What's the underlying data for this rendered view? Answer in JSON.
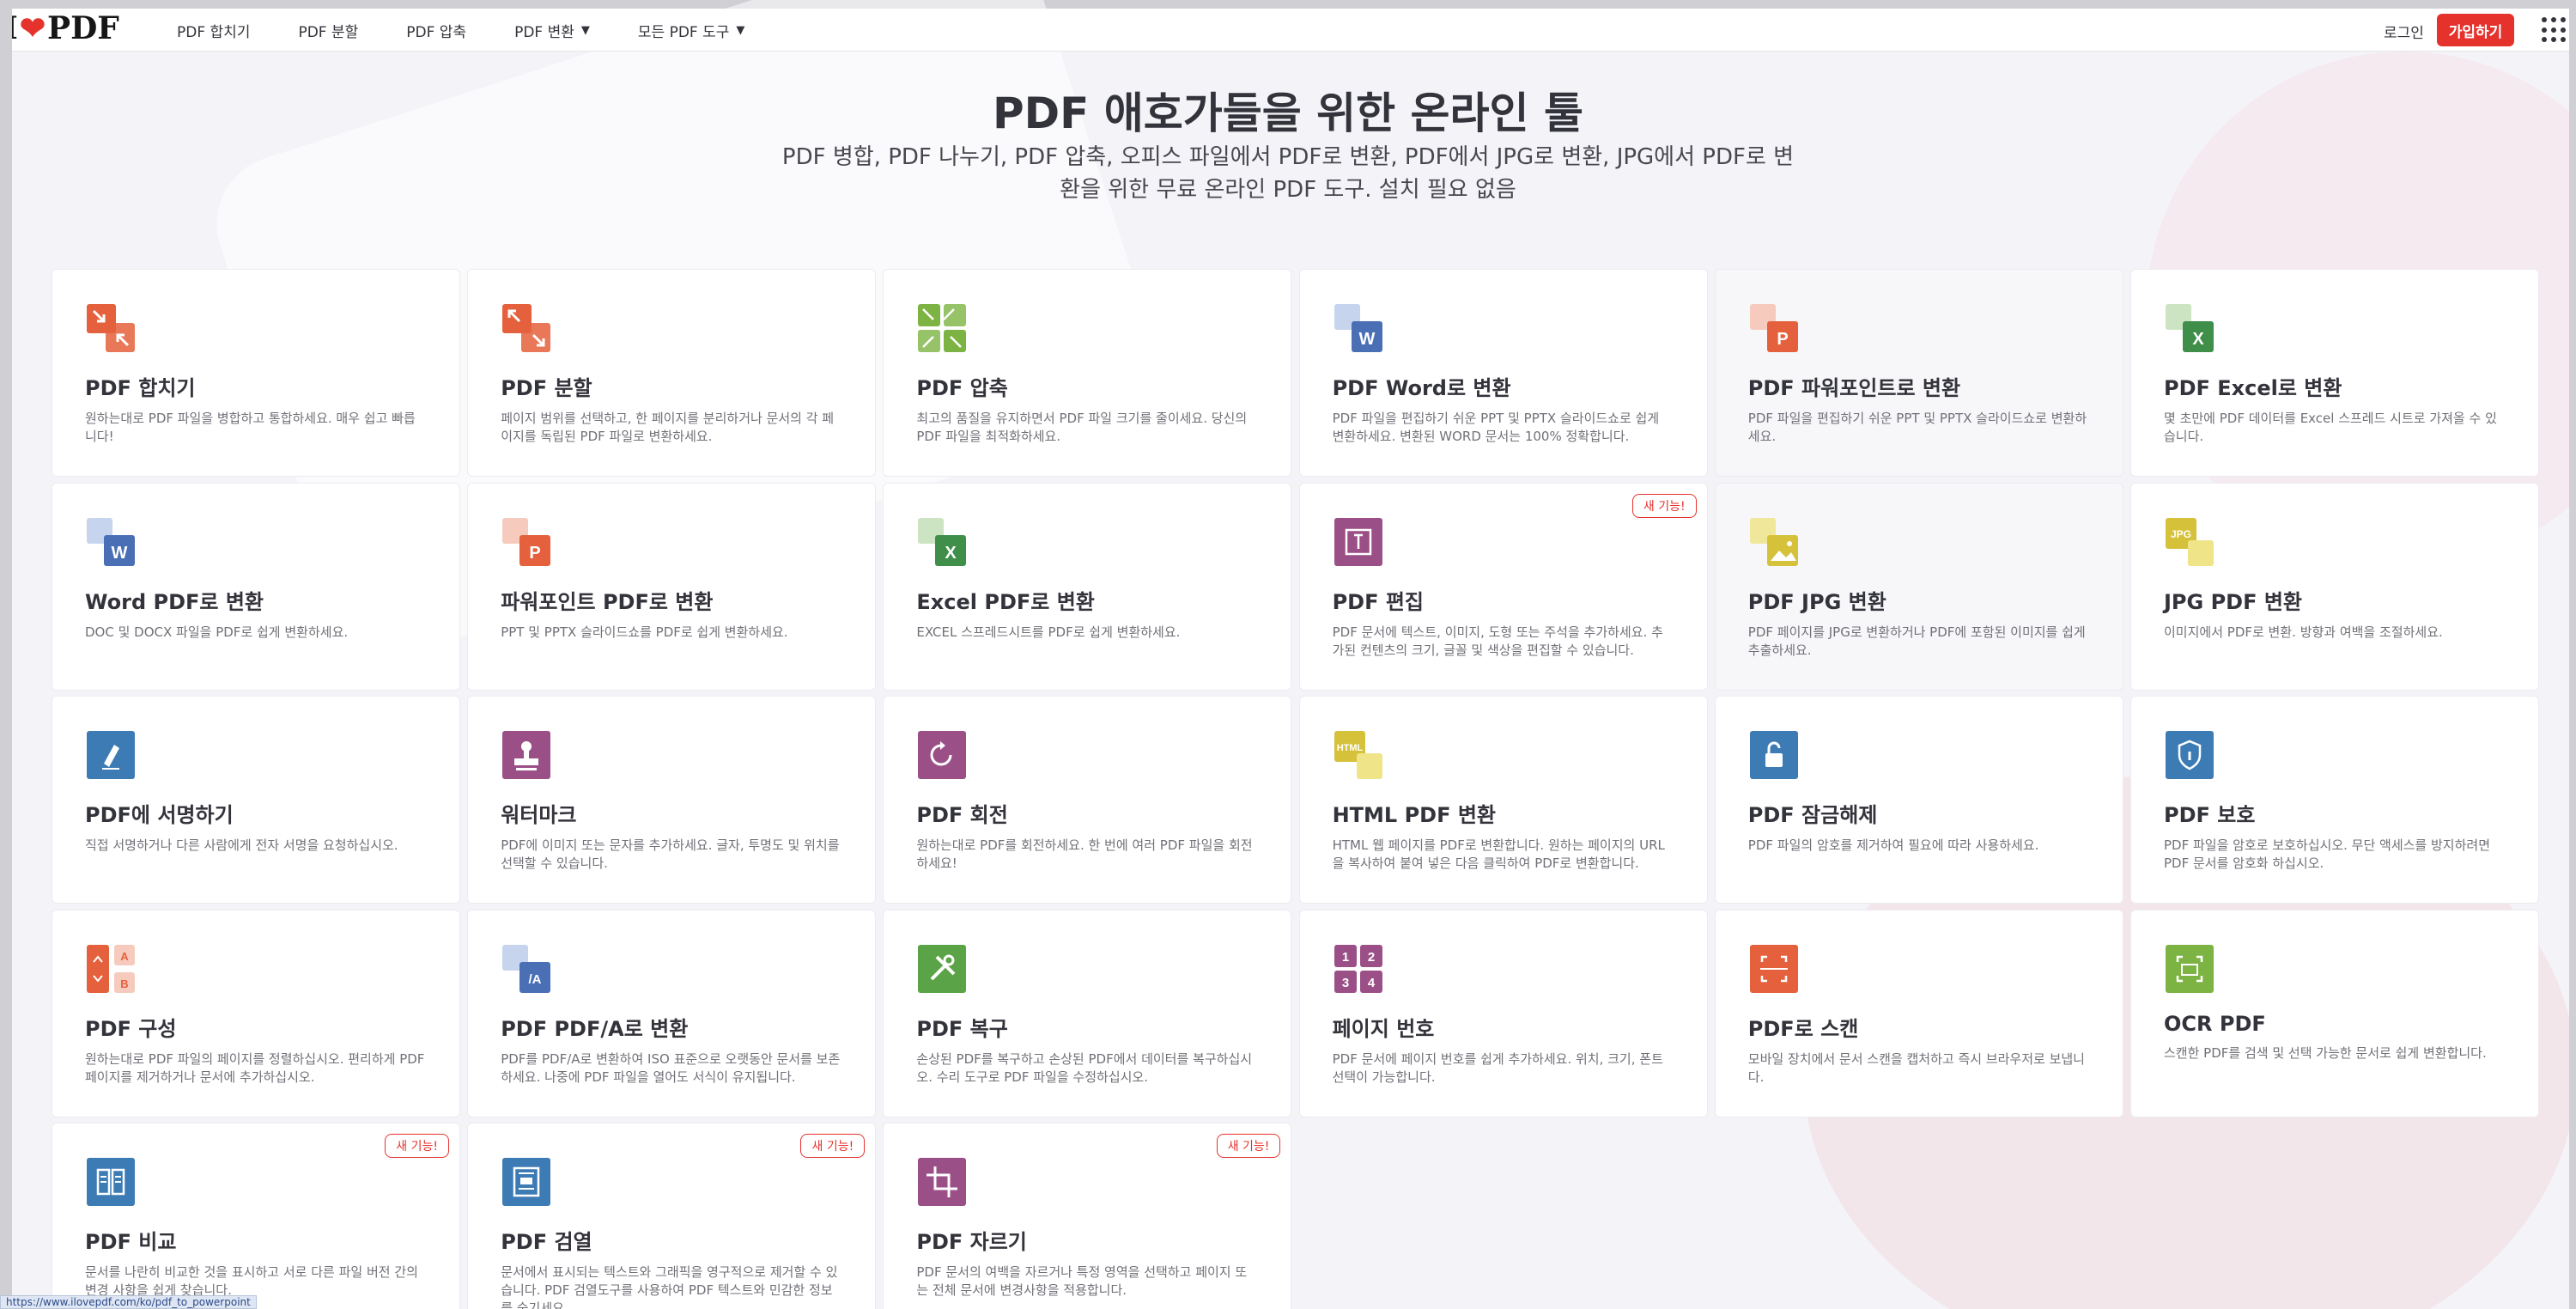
{
  "header": {
    "logo": {
      "prefix": "I",
      "suffix": "PDF"
    },
    "nav": [
      {
        "label": "PDF 합치기",
        "caret": false
      },
      {
        "label": "PDF 분할",
        "caret": false
      },
      {
        "label": "PDF 압축",
        "caret": false
      },
      {
        "label": "PDF 변환",
        "caret": true
      },
      {
        "label": "모든 PDF 도구",
        "caret": true
      }
    ],
    "login_label": "로그인",
    "signup_label": "가입하기"
  },
  "hero": {
    "title": "PDF 애호가들을 위한 온라인 툴",
    "subtitle": "PDF 병합, PDF 나누기, PDF 압축, 오피스 파일에서 PDF로 변환, PDF에서 JPG로 변환, JPG에서 PDF로 변환을 위한 무료 온라인 PDF 도구. 설치 필요 없음"
  },
  "new_badge_label": "새 기능!",
  "status_url": "https://www.ilovepdf.com/ko/pdf_to_powerpoint",
  "colors": {
    "brand": "#e5322d",
    "orange": "#e5603c",
    "green": "#7cb342",
    "blue": "#4a6fb5",
    "purple": "#9b4f87",
    "yellow": "#d6c13a",
    "teal": "#3d7bb5"
  },
  "tools": [
    {
      "name": "merge",
      "icon": "merge-icon",
      "title": "PDF 합치기",
      "desc": "원하는대로 PDF 파일을 병합하고 통합하세요. 매우 쉽고 빠릅니다!",
      "new": false
    },
    {
      "name": "split",
      "icon": "split-icon",
      "title": "PDF 분할",
      "desc": "페이지 범위를 선택하고, 한 페이지를 분리하거나 문서의 각 페이지를 독립된 PDF 파일로 변환하세요.",
      "new": false
    },
    {
      "name": "compress",
      "icon": "compress-icon",
      "title": "PDF 압축",
      "desc": "최고의 품질을 유지하면서 PDF 파일 크기를 줄이세요. 당신의 PDF 파일을 최적화하세요.",
      "new": false
    },
    {
      "name": "pdf-to-word",
      "icon": "word-icon",
      "title": "PDF Word로 변환",
      "desc": "PDF 파일을 편집하기 쉬운 PPT 및 PPTX 슬라이드쇼로 쉽게 변환하세요. 변환된 WORD 문서는 100% 정확합니다.",
      "new": false
    },
    {
      "name": "pdf-to-powerpoint",
      "icon": "powerpoint-icon",
      "title": "PDF 파워포인트로 변환",
      "desc": "PDF 파일을 편집하기 쉬운 PPT 및 PPTX 슬라이드쇼로 변환하세요.",
      "new": false
    },
    {
      "name": "pdf-to-excel",
      "icon": "excel-icon",
      "title": "PDF Excel로 변환",
      "desc": "몇 초만에 PDF 데이터를 Excel 스프레드 시트로 가져올 수 있습니다.",
      "new": false
    },
    {
      "name": "word-to-pdf",
      "icon": "word-icon",
      "title": "Word PDF로 변환",
      "desc": "DOC 및 DOCX 파일을 PDF로 쉽게 변환하세요.",
      "new": false
    },
    {
      "name": "powerpoint-to-pdf",
      "icon": "powerpoint-icon",
      "title": "파워포인트 PDF로 변환",
      "desc": "PPT 및 PPTX 슬라이드쇼를 PDF로 쉽게 변환하세요.",
      "new": false
    },
    {
      "name": "excel-to-pdf",
      "icon": "excel-icon",
      "title": "Excel PDF로 변환",
      "desc": "EXCEL 스프레드시트를 PDF로 쉽게 변환하세요.",
      "new": false
    },
    {
      "name": "edit",
      "icon": "edit-icon",
      "title": "PDF 편집",
      "desc": "PDF 문서에 텍스트, 이미지, 도형 또는 주석을 추가하세요. 추가된 컨텐츠의 크기, 글꼴 및 색상을 편집할 수 있습니다.",
      "new": true
    },
    {
      "name": "pdf-to-jpg",
      "icon": "image-icon",
      "title": "PDF JPG 변환",
      "desc": "PDF 페이지를 JPG로 변환하거나 PDF에 포함된 이미지를 쉽게 추출하세요.",
      "new": false
    },
    {
      "name": "jpg-to-pdf",
      "icon": "jpg-icon",
      "title": "JPG PDF 변환",
      "desc": "이미지에서 PDF로 변환. 방향과 여백을 조절하세요.",
      "new": false
    },
    {
      "name": "sign",
      "icon": "pen-icon",
      "title": "PDF에 서명하기",
      "desc": "직접 서명하거나 다른 사람에게 전자 서명을 요청하십시오.",
      "new": false
    },
    {
      "name": "watermark",
      "icon": "stamp-icon",
      "title": "워터마크",
      "desc": "PDF에 이미지 또는 문자를 추가하세요. 글자, 투명도 및 위치를 선택할 수 있습니다.",
      "new": false
    },
    {
      "name": "rotate",
      "icon": "rotate-icon",
      "title": "PDF 회전",
      "desc": "원하는대로 PDF를 회전하세요. 한 번에 여러 PDF 파일을 회전하세요!",
      "new": false
    },
    {
      "name": "html-to-pdf",
      "icon": "html-icon",
      "title": "HTML PDF 변환",
      "desc": "HTML 웹 페이지를 PDF로 변환합니다. 원하는 페이지의 URL을 복사하여 붙여 넣은 다음 클릭하여 PDF로 변환합니다.",
      "new": false
    },
    {
      "name": "unlock",
      "icon": "unlock-icon",
      "title": "PDF 잠금해제",
      "desc": "PDF 파일의 암호를 제거하여 필요에 따라 사용하세요.",
      "new": false
    },
    {
      "name": "protect",
      "icon": "shield-icon",
      "title": "PDF 보호",
      "desc": "PDF 파일을 암호로 보호하십시오. 무단 액세스를 방지하려면 PDF 문서를 암호화 하십시오.",
      "new": false
    },
    {
      "name": "organize",
      "icon": "organize-icon",
      "title": "PDF 구성",
      "desc": "원하는대로 PDF 파일의 페이지를 정렬하십시오. 편리하게 PDF 페이지를 제거하거나 문서에 추가하십시오.",
      "new": false
    },
    {
      "name": "pdf-to-pdfa",
      "icon": "pdfa-icon",
      "title": "PDF PDF/A로 변환",
      "desc": "PDF를 PDF/A로 변환하여 ISO 표준으로 오랫동안 문서를 보존하세요. 나중에 PDF 파일을 열어도 서식이 유지됩니다.",
      "new": false
    },
    {
      "name": "repair",
      "icon": "repair-icon",
      "title": "PDF 복구",
      "desc": "손상된 PDF를 복구하고 손상된 PDF에서 데이터를 복구하십시오. 수리 도구로 PDF 파일을 수정하십시오.",
      "new": false
    },
    {
      "name": "page-numbers",
      "icon": "numbers-icon",
      "title": "페이지 번호",
      "desc": "PDF 문서에 페이지 번호를 쉽게 추가하세요. 위치, 크기, 폰트 선택이 가능합니다.",
      "new": false
    },
    {
      "name": "scan",
      "icon": "scan-icon",
      "title": "PDF로 스캔",
      "desc": "모바일 장치에서 문서 스캔을 캡처하고 즉시 브라우저로 보냅니다.",
      "new": false
    },
    {
      "name": "ocr",
      "icon": "ocr-icon",
      "title": "OCR PDF",
      "desc": "스캔한 PDF를 검색 및 선택 가능한 문서로 쉽게 변환합니다.",
      "new": false
    },
    {
      "name": "compare",
      "icon": "compare-icon",
      "title": "PDF 비교",
      "desc": "문서를 나란히 비교한 것을 표시하고 서로 다른 파일 버전 간의 변경 사항을 쉽게 찾습니다.",
      "new": true
    },
    {
      "name": "redact",
      "icon": "redact-icon",
      "title": "PDF 검열",
      "desc": "문서에서 표시되는 텍스트와 그래픽을 영구적으로 제거할 수 있습니다. PDF 검열도구를 사용하여 PDF 텍스트와 민감한 정보를 숨기세요.",
      "new": true
    },
    {
      "name": "crop",
      "icon": "crop-icon",
      "title": "PDF 자르기",
      "desc": "PDF 문서의 여백을 자르거나 특정 영역을 선택하고 페이지 또는 전체 문서에 변경사항을 적용합니다.",
      "new": true
    }
  ]
}
